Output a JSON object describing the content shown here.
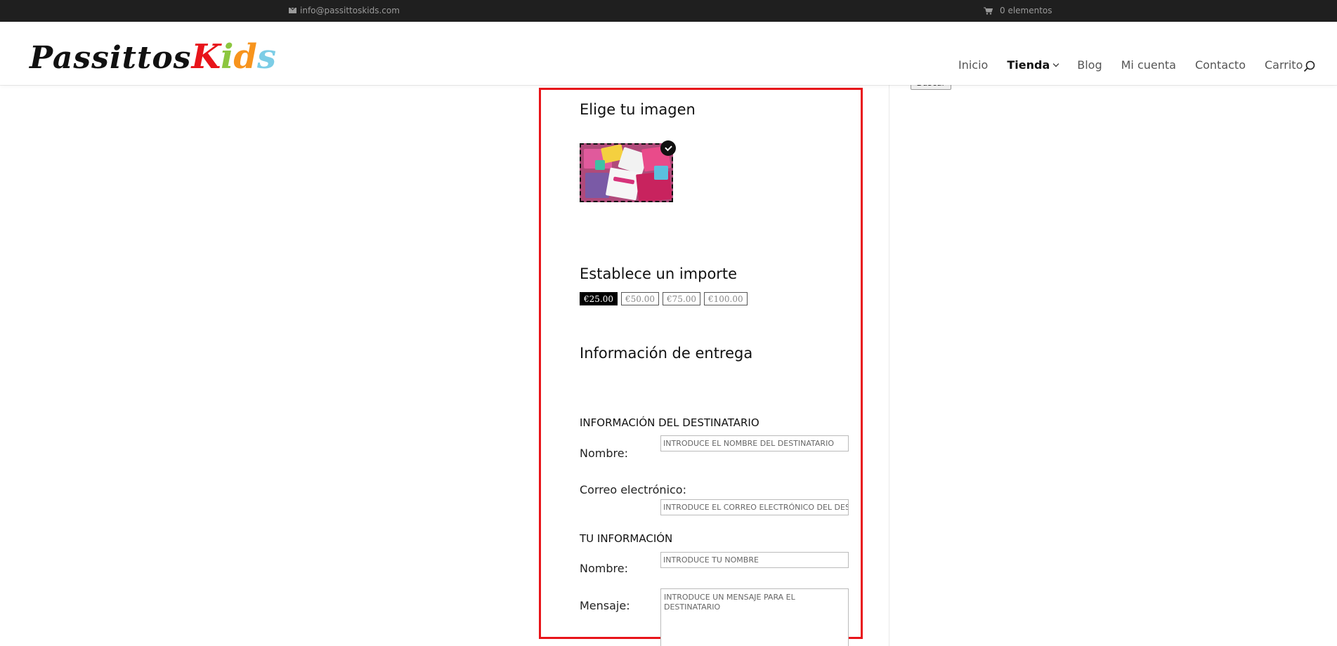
{
  "topbar": {
    "email": "info@passittoskids.com",
    "cart": "0 elementos"
  },
  "header": {
    "logo_part1": "Passittos",
    "logo_part2": [
      "K",
      "i",
      "d",
      "s"
    ],
    "logo_part2_colors": [
      "#e8141a",
      "#e8141a",
      "#8cc63f",
      "#f7941d",
      "#7ccde6"
    ],
    "nav": {
      "inicio": "Inicio",
      "tienda": "Tienda",
      "blog": "Blog",
      "mi_cuenta": "Mi cuenta",
      "contacto": "Contacto",
      "carrito": "Carrito"
    }
  },
  "sidebar": {
    "search_button": "Buscar"
  },
  "form": {
    "choose_image_title": "Elige tu imagen",
    "amount_title": "Establece un importe",
    "amounts": [
      "€25.00",
      "€50.00",
      "€75.00",
      "€100.00"
    ],
    "selected_amount": "€25.00",
    "delivery_title": "Información de entrega",
    "recipient_section": "INFORMACIÓN DEL DESTINATARIO",
    "recipient_name_label": "Nombre:",
    "recipient_name_placeholder": "INTRODUCE EL NOMBRE DEL DESTINATARIO",
    "recipient_email_label": "Correo electrónico:",
    "recipient_email_placeholder": "INTRODUCE EL CORREO ELECTRÓNICO DEL DESTINATARIO",
    "your_info_section": "TU INFORMACIÓN",
    "your_name_label": "Nombre:",
    "your_name_placeholder": "INTRODUCE TU NOMBRE",
    "message_label": "Mensaje:",
    "message_placeholder": "INTRODUCE UN MENSAJE PARA EL DESTINATARIO"
  },
  "colors": {
    "highlight": "#e8141a",
    "topbar_bg": "#1f1f1f"
  }
}
